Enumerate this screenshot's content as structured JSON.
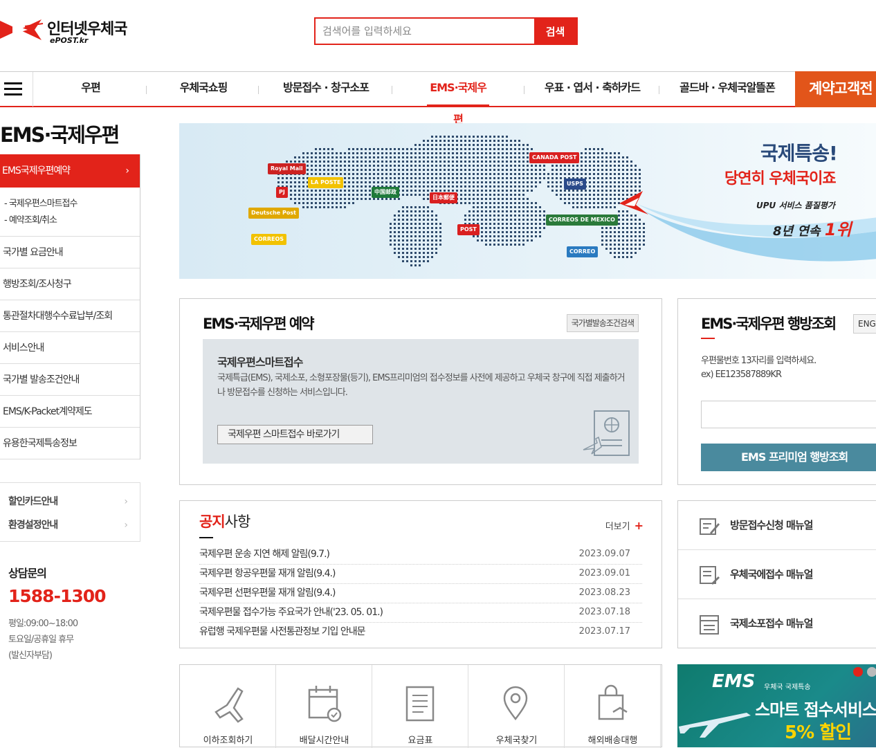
{
  "header": {
    "logo_text": "인터넷우체국",
    "logo_sub": "ePOST.kr",
    "search_placeholder": "검색어를 입력하세요",
    "search_button": "검색"
  },
  "gnb": {
    "items": [
      "우편",
      "우체국쇼핑",
      "방문접수 · 창구소포",
      "EMS·국제우편",
      "우표 · 엽서 · 축하카드",
      "골드바 · 우체국알뜰폰"
    ],
    "contract": "계약고객전"
  },
  "sidebar": {
    "title": "EMS·국제우편",
    "active": "EMS국제우편예약",
    "active_arrow": "›",
    "sub": [
      "- 국제우편스마트접수",
      "- 예약조회/취소"
    ],
    "items": [
      "국가별 요금안내",
      "행방조회/조사청구",
      "통관절차대행수수료납부/조회",
      "서비스안내",
      "국가별 발송조건안내",
      "EMS/K-Packet계약제도",
      "유용한국제특송정보"
    ],
    "extra": [
      "할인카드안내",
      "환경설정안내"
    ],
    "extra_arrow": "›",
    "consult_title": "상담문의",
    "consult_phone": "1588-1300",
    "consult_hours": [
      "평일:09:00~18:00",
      "토요일/공휴일 휴무",
      "(발신자부담)"
    ]
  },
  "banner": {
    "line1": "국제특송!",
    "line2": "당연히 우체국이죠",
    "line3": "UPU 서비스 품질평가",
    "line4_a": "8년 연속",
    "line4_b": "1위",
    "flags": [
      {
        "text": "Royal Mail",
        "color": "#cc2222"
      },
      {
        "text": "LA POSTE",
        "color": "#f2c200"
      },
      {
        "text": "PJ",
        "color": "#d92020"
      },
      {
        "text": "Deutsche Post",
        "color": "#e0a800"
      },
      {
        "text": "CORREOS",
        "color": "#f2c200"
      },
      {
        "text": "中国邮政",
        "color": "#1f7a3a"
      },
      {
        "text": "日本郵便",
        "color": "#d92020"
      },
      {
        "text": "POST",
        "color": "#d92020"
      },
      {
        "text": "USPS",
        "color": "#2a4a8a"
      },
      {
        "text": "CANADA POST",
        "color": "#d92020"
      },
      {
        "text": "CORREOS DE MEXICO",
        "color": "#2a7a3a"
      },
      {
        "text": "CORREO",
        "color": "#2a7ac0"
      }
    ]
  },
  "reserve": {
    "title": "EMS·국제우편 예약",
    "cond_button": "국가별발송조건검색",
    "heading": "국제우편스마트접수",
    "description": "국제특급(EMS), 국제소포, 소형포장물(등기), EMS프리미엄의 접수정보를 사전에 제공하고 우체국 창구에 직접 제출하거나 방문접수를 신청하는 서비스입니다.",
    "go_button": "국제우편 스마트접수 바로가기"
  },
  "tracking": {
    "title": "EMS·국제우편 행방조회",
    "lang": "ENGLISH",
    "hint1": "우편물번호 13자리를 입력하세요.",
    "hint2": "ex) EE123587889KR",
    "premium_button": "EMS 프리미엄 행방조회"
  },
  "notice": {
    "title_a": "공지",
    "title_b": "사항",
    "more": "더보기",
    "more_icon": "+",
    "items": [
      {
        "title": "국제우편 운송 지연 해제 알림(9.7.)",
        "date": "2023.09.07"
      },
      {
        "title": "국제우편 항공우편물 재개 알림(9.4.)",
        "date": "2023.09.01"
      },
      {
        "title": "국제우편 선편우편물 재개 알림(9.4.)",
        "date": "2023.08.23"
      },
      {
        "title": "국제우편물 접수가능 주요국가 안내('23. 05. 01.)",
        "date": "2023.07.18"
      },
      {
        "title": "유럽행 국제우편물 사전통관정보 기입 안내문",
        "date": "2023.07.17"
      }
    ]
  },
  "manuals": [
    "방문접수신청 매뉴얼",
    "우체국에접수 매뉴얼",
    "국제소포접수 매뉴얼"
  ],
  "quick_icons": [
    {
      "icon": "plane-icon",
      "label": "이하조회하기"
    },
    {
      "icon": "calendar-icon",
      "label": "배달시간안내"
    },
    {
      "icon": "document-icon",
      "label": "요금표"
    },
    {
      "icon": "location-icon",
      "label": "우체국찾기"
    },
    {
      "icon": "bag-icon",
      "label": "해외배송대행"
    }
  ],
  "ems_ad": {
    "logo": "EMS",
    "small": "우체국 국제특송",
    "line2": "스마트 접수서비스",
    "line3": "5% 할인"
  },
  "colors": {
    "brand_red": "#e2231a",
    "contract_orange": "#e2551a",
    "premium_teal": "#4a8a9e"
  }
}
